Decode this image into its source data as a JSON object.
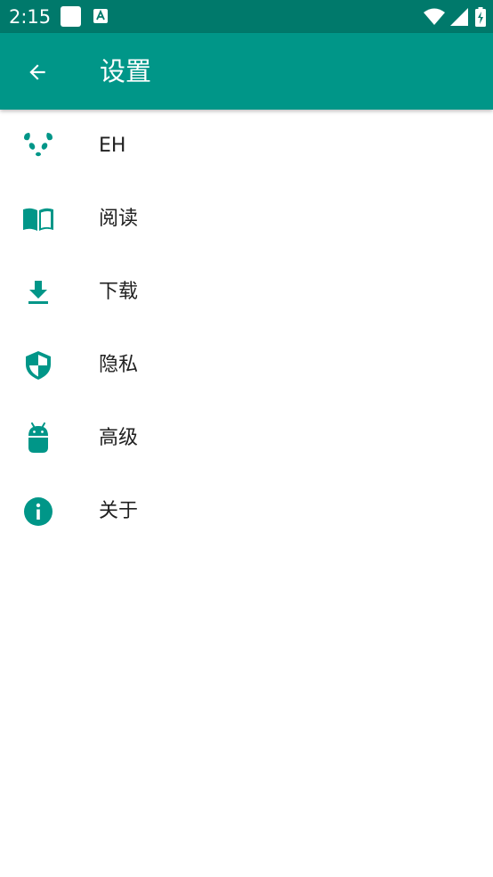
{
  "status_bar": {
    "time": "2:15",
    "background": "#00796b"
  },
  "app_bar": {
    "title": "设置",
    "background": "#009688",
    "back_icon": "arrow-back-icon"
  },
  "accent_color": "#009688",
  "settings": {
    "items": [
      {
        "label": "EH",
        "icon": "panda-icon"
      },
      {
        "label": "阅读",
        "icon": "book-icon"
      },
      {
        "label": "下载",
        "icon": "download-icon"
      },
      {
        "label": "隐私",
        "icon": "shield-icon"
      },
      {
        "label": "高级",
        "icon": "android-icon"
      },
      {
        "label": "关于",
        "icon": "info-icon"
      }
    ]
  }
}
